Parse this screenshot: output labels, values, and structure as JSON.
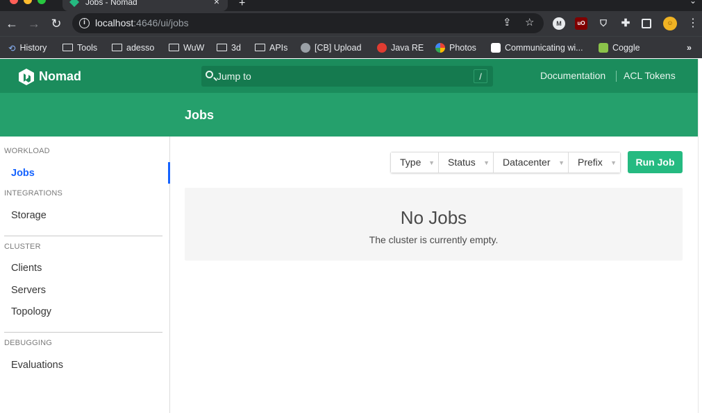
{
  "browser": {
    "tab_title": "Jobs - Nomad",
    "url_host": "localhost",
    "url_path": ":4646/ui/jobs",
    "bookmarks": [
      {
        "label": "History",
        "icon": "history-icon"
      },
      {
        "label": "Tools",
        "icon": "folder-icon"
      },
      {
        "label": "adesso",
        "icon": "folder-icon"
      },
      {
        "label": "WuW",
        "icon": "folder-icon"
      },
      {
        "label": "3d",
        "icon": "folder-icon"
      },
      {
        "label": "APIs",
        "icon": "folder-icon"
      },
      {
        "label": "[CB] Upload",
        "icon": "globe-icon"
      },
      {
        "label": "Java RE",
        "icon": "java-icon"
      },
      {
        "label": "Photos",
        "icon": "photos-icon"
      },
      {
        "label": "Communicating wi...",
        "icon": "medium-icon"
      },
      {
        "label": "Coggle",
        "icon": "coggle-icon"
      }
    ]
  },
  "header": {
    "brand": "Nomad",
    "search_placeholder": "Jump to",
    "search_shortcut": "/",
    "links": [
      "Documentation",
      "ACL Tokens"
    ]
  },
  "page": {
    "title": "Jobs"
  },
  "sidebar": {
    "workload_label": "WORKLOAD",
    "jobs": "Jobs",
    "integrations_label": "INTEGRATIONS",
    "storage": "Storage",
    "cluster_label": "CLUSTER",
    "clients": "Clients",
    "servers": "Servers",
    "topology": "Topology",
    "debugging_label": "DEBUGGING",
    "evaluations": "Evaluations"
  },
  "filters": [
    "Type",
    "Status",
    "Datacenter",
    "Prefix"
  ],
  "run_job": "Run Job",
  "empty": {
    "title": "No Jobs",
    "message": "The cluster is currently empty."
  },
  "colors": {
    "header": "#1b8c5c",
    "subnav": "#25a06c",
    "primary_button": "#25ba81",
    "active_link": "#1563ff"
  }
}
